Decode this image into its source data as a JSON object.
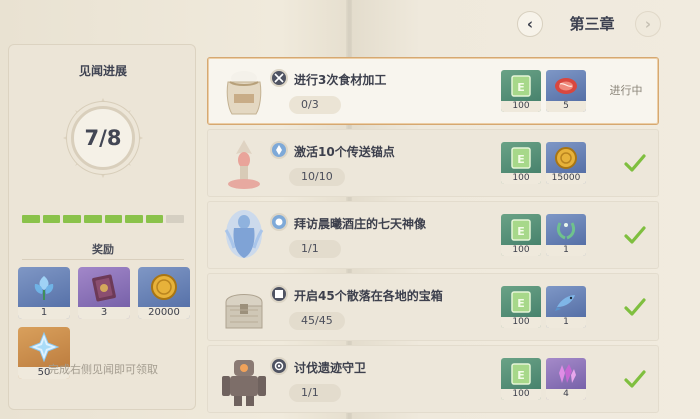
{
  "header": {
    "chapter_title": "第三章",
    "prev_icon": "chevron-left-icon",
    "next_icon": "chevron-right-icon"
  },
  "left_panel": {
    "title": "见闻进展",
    "progress_text": "7/8",
    "progress_done": 7,
    "progress_total": 8,
    "reward_title": "奖励",
    "rewards": [
      {
        "icon": "blue-flower-icon",
        "count": "1",
        "rarity": "blue"
      },
      {
        "icon": "purple-book-icon",
        "count": "3",
        "rarity": "purple"
      },
      {
        "icon": "mora-coin-icon",
        "count": "20000",
        "rarity": "blue"
      },
      {
        "icon": "primogem-icon",
        "count": "50",
        "rarity": "gold"
      }
    ],
    "footer": "完成右侧见闻即可领取"
  },
  "tasks": [
    {
      "title": "进行3次食材加工",
      "progress": "0/3",
      "type_icon": "crafting-icon",
      "thumb": "flour-sack",
      "rewards": [
        {
          "icon": "adventure-exp-icon",
          "count": "100",
          "rarity": "green"
        },
        {
          "icon": "raw-meat-icon",
          "count": "5",
          "rarity": "blue"
        }
      ],
      "status": "进行中",
      "completed": false
    },
    {
      "title": "激活10个传送锚点",
      "progress": "10/10",
      "type_icon": "waypoint-icon",
      "thumb": "teleport-waypoint",
      "rewards": [
        {
          "icon": "adventure-exp-icon",
          "count": "100",
          "rarity": "green"
        },
        {
          "icon": "mora-coin-icon",
          "count": "15000",
          "rarity": "blue"
        }
      ],
      "status": "",
      "completed": true
    },
    {
      "title": "拜访晨曦酒庄的七天神像",
      "progress": "1/1",
      "type_icon": "statue-icon",
      "thumb": "statue-of-seven",
      "rewards": [
        {
          "icon": "adventure-exp-icon",
          "count": "100",
          "rarity": "green"
        },
        {
          "icon": "laurel-wreath-icon",
          "count": "1",
          "rarity": "blue"
        }
      ],
      "status": "",
      "completed": true
    },
    {
      "title": "开启45个散落在各地的宝箱",
      "progress": "45/45",
      "type_icon": "chest-icon",
      "thumb": "treasure-chest",
      "rewards": [
        {
          "icon": "adventure-exp-icon",
          "count": "100",
          "rarity": "green"
        },
        {
          "icon": "blue-fish-icon",
          "count": "1",
          "rarity": "blue"
        }
      ],
      "status": "",
      "completed": true
    },
    {
      "title": "讨伐遗迹守卫",
      "progress": "1/1",
      "type_icon": "boss-icon",
      "thumb": "ruin-guard",
      "rewards": [
        {
          "icon": "adventure-exp-icon",
          "count": "100",
          "rarity": "green"
        },
        {
          "icon": "purple-crystal-icon",
          "count": "4",
          "rarity": "purple"
        }
      ],
      "status": "",
      "completed": true
    }
  ],
  "colors": {
    "progress_on": "#8ac24a",
    "progress_off": "#d5cfc2",
    "check": "#7fbf3f",
    "active_border": "#d6a871"
  }
}
